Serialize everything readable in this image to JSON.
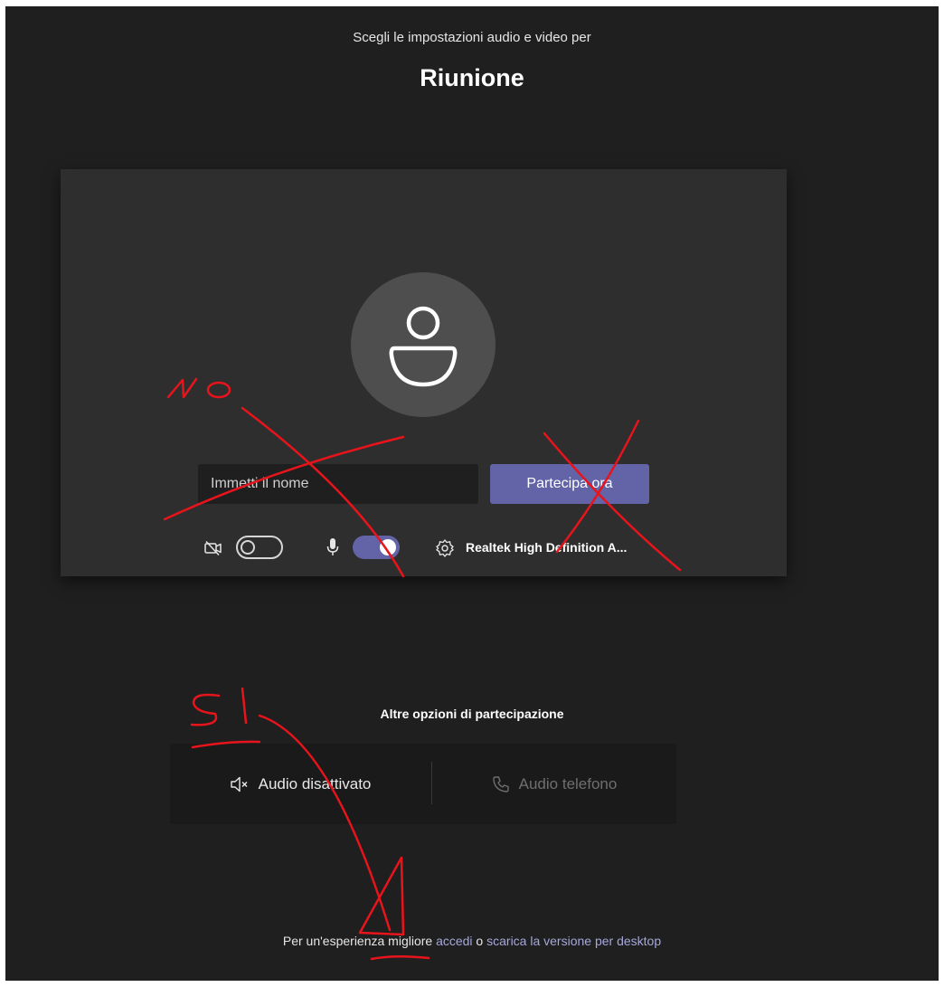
{
  "header": {
    "subtitle": "Scegli le impostazioni audio e video per",
    "title": "Riunione"
  },
  "preview": {
    "name_placeholder": "Immetti il nome",
    "join_label": "Partecipa ora",
    "camera_toggle": "off",
    "mic_toggle": "on",
    "device_label": "Realtek High Definition A..."
  },
  "other_options": {
    "title": "Altre opzioni di partecipazione",
    "audio_off_label": "Audio disattivato",
    "phone_audio_label": "Audio telefono"
  },
  "footer": {
    "prefix": "Per un'esperienza migliore ",
    "signin_link": "accedi",
    "middle": " o ",
    "download_link": "scarica la versione per desktop"
  },
  "annotations": {
    "no_text": "NO",
    "si_text": "SI",
    "color": "#e8141b"
  },
  "colors": {
    "background": "#1f1f1f",
    "panel": "#2e2e2e",
    "accent": "#6264a7",
    "link": "#a6a7dc"
  }
}
